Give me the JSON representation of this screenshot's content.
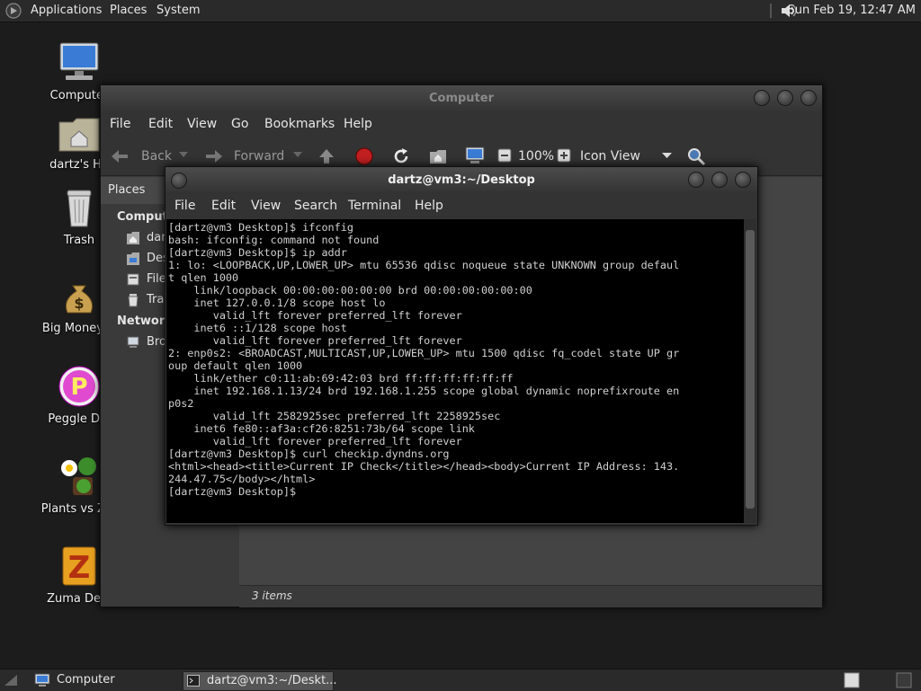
{
  "top_panel": {
    "menus": [
      "Applications",
      "Places",
      "System"
    ],
    "clock": "Sun Feb 19, 12:47 AM"
  },
  "desktop": {
    "icons": [
      "Computer",
      "dartz's Ho",
      "Trash",
      "Big Money D",
      "Peggle Del",
      "Plants vs Zor",
      "Zuma Delu"
    ]
  },
  "file_manager": {
    "title": "Computer",
    "menu": [
      "File",
      "Edit",
      "View",
      "Go",
      "Bookmarks",
      "Help"
    ],
    "toolbar": {
      "back": "Back",
      "forward": "Forward",
      "zoom": "100%",
      "view_mode": "Icon View"
    },
    "sidebar": {
      "header": "Places",
      "section_computer": "Compute",
      "items": [
        "dar",
        "Des",
        "File",
        "Tra"
      ],
      "section_network": "Network",
      "network_items": [
        "Bro"
      ]
    },
    "status": "3 items"
  },
  "terminal": {
    "title": "dartz@vm3:~/Desktop",
    "menu": [
      "File",
      "Edit",
      "View",
      "Search",
      "Terminal",
      "Help"
    ],
    "output": "[dartz@vm3 Desktop]$ ifconfig\nbash: ifconfig: command not found\n[dartz@vm3 Desktop]$ ip addr\n1: lo: <LOOPBACK,UP,LOWER_UP> mtu 65536 qdisc noqueue state UNKNOWN group defaul\nt qlen 1000\n    link/loopback 00:00:00:00:00:00 brd 00:00:00:00:00:00\n    inet 127.0.0.1/8 scope host lo\n       valid_lft forever preferred_lft forever\n    inet6 ::1/128 scope host\n       valid_lft forever preferred_lft forever\n2: enp0s2: <BROADCAST,MULTICAST,UP,LOWER_UP> mtu 1500 qdisc fq_codel state UP gr\noup default qlen 1000\n    link/ether c0:11:ab:69:42:03 brd ff:ff:ff:ff:ff:ff\n    inet 192.168.1.13/24 brd 192.168.1.255 scope global dynamic noprefixroute en\np0s2\n       valid_lft 2582925sec preferred_lft 2258925sec\n    inet6 fe80::af3a:cf26:8251:73b/64 scope link\n       valid_lft forever preferred_lft forever\n[dartz@vm3 Desktop]$ curl checkip.dyndns.org\n<html><head><title>Current IP Check</title></head><body>Current IP Address: 143.\n244.47.75</body></html>\n[dartz@vm3 Desktop]$"
  },
  "taskbar": {
    "items": [
      "Computer",
      "dartz@vm3:~/Deskt..."
    ]
  }
}
